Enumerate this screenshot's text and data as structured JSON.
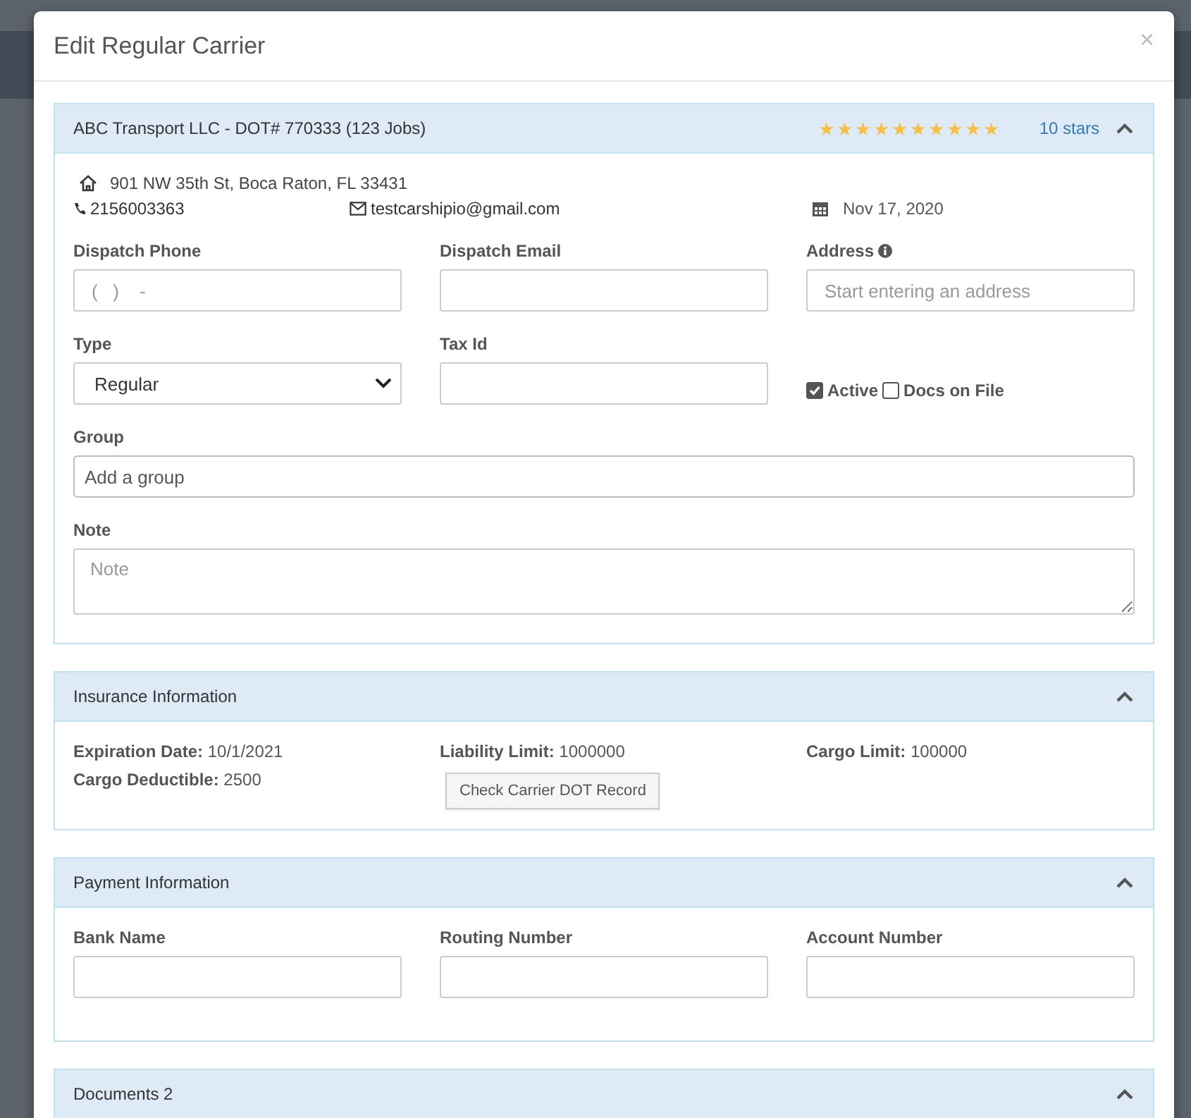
{
  "modal": {
    "title": "Edit Regular Carrier",
    "close": "×"
  },
  "carrier_panel": {
    "title": "ABC Transport LLC - DOT# 770333 (123 Jobs)",
    "stars": 10,
    "stars_text": "10 stars",
    "expanded": true,
    "address": "901 NW 35th St, Boca Raton, FL 33431",
    "phone": "2156003363",
    "email": "testcarshipio@gmail.com",
    "date": "Nov 17, 2020",
    "fields": [
      {
        "kind": "input",
        "label": "Dispatch Phone",
        "placeholder": "(   )    -"
      },
      {
        "kind": "input",
        "label": "Dispatch Email"
      },
      {
        "kind": "input",
        "label": "Address",
        "placeholder": "Start entering an address",
        "info": true
      },
      {
        "kind": "select",
        "label": "Type",
        "value": "Regular"
      },
      {
        "kind": "input",
        "label": "Tax Id"
      },
      {
        "kind": "checks",
        "options": [
          {
            "label": "Active",
            "checked": true
          },
          {
            "label": "Docs on File",
            "checked": false
          }
        ]
      },
      {
        "kind": "wide-input",
        "label": "Group",
        "placeholder": "Add a group"
      },
      {
        "kind": "textarea",
        "label": "Note",
        "placeholder": "Note"
      }
    ]
  },
  "insurance_panel": {
    "title": "Insurance Information",
    "expanded": true,
    "items": [
      {
        "label": "Expiration Date:",
        "value": "10/1/2021"
      },
      {
        "label": "Liability Limit:",
        "value": "1000000"
      },
      {
        "label": "Cargo Limit:",
        "value": "100000"
      },
      {
        "label": "Cargo Deductible:",
        "value": "2500"
      }
    ],
    "button": "Check Carrier DOT Record"
  },
  "payment_panel": {
    "title": "Payment Information",
    "expanded": true,
    "fields": [
      {
        "label": "Bank Name"
      },
      {
        "label": "Routing Number"
      },
      {
        "label": "Account Number"
      }
    ]
  },
  "documents_panel": {
    "title": "Documents 2",
    "expanded": true
  }
}
